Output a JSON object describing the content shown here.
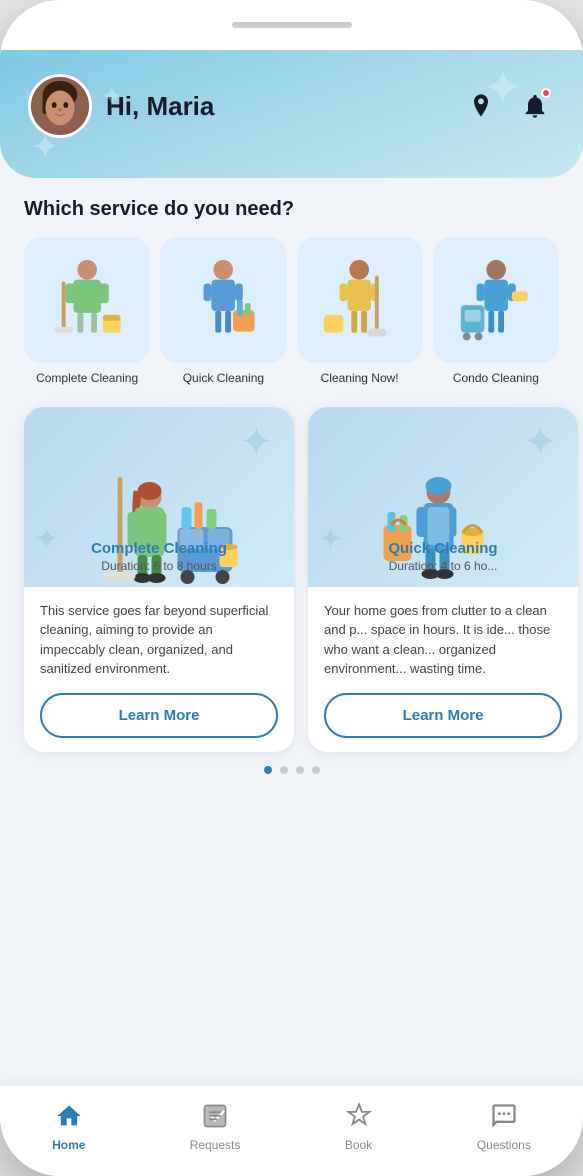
{
  "header": {
    "greeting": "Hi, Maria",
    "sparkles": [
      "✦",
      "✦",
      "✦"
    ]
  },
  "section": {
    "title": "Which service do you need?"
  },
  "services": [
    {
      "id": "complete-cleaning",
      "label": "Complete\nCleaning"
    },
    {
      "id": "quick-cleaning",
      "label": "Quick\nCleaning"
    },
    {
      "id": "cleaning-now",
      "label": "Cleaning\nNow!"
    },
    {
      "id": "condo-cleaning",
      "label": "Condo\nCleaning"
    }
  ],
  "featured": [
    {
      "id": "complete-cleaning-card",
      "name": "Complete Cleaning",
      "duration": "Duration: 6 to 8 hours",
      "description": "This service goes far beyond superficial cleaning, aiming to provide an impeccably clean, organized, and sanitized environment.",
      "button": "Learn More"
    },
    {
      "id": "quick-cleaning-card",
      "name": "Quick Cleaning",
      "duration": "Duration: 4 to 6 ho...",
      "description": "Your home goes from clutter to a clean and p... space in hours. It is ide... those who want a clean... organized environment... wasting time.",
      "button": "Learn More"
    }
  ],
  "dots": [
    "active",
    "inactive",
    "inactive",
    "inactive"
  ],
  "nav": [
    {
      "id": "home",
      "label": "Home",
      "icon": "⌂",
      "active": true
    },
    {
      "id": "requests",
      "label": "Requests",
      "icon": "📋",
      "active": false
    },
    {
      "id": "book",
      "label": "Book",
      "icon": "✦",
      "active": false
    },
    {
      "id": "questions",
      "label": "Questions",
      "icon": "💬",
      "active": false
    }
  ]
}
